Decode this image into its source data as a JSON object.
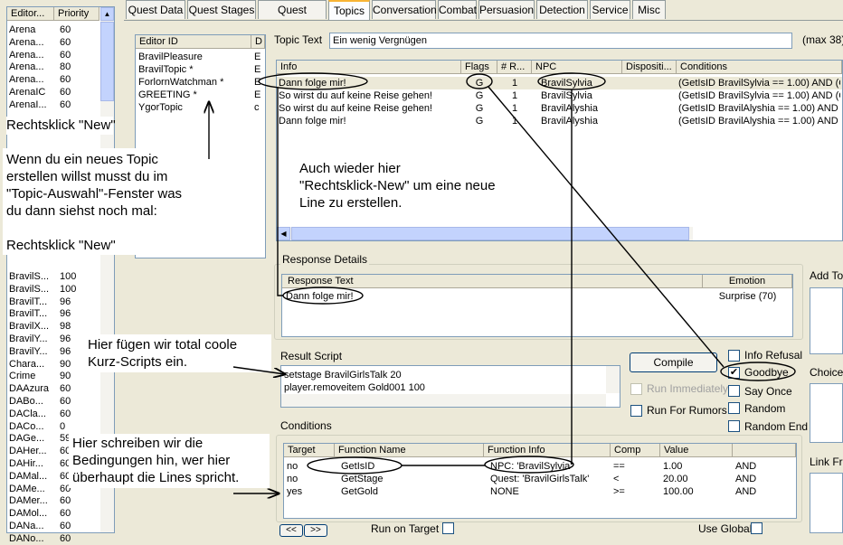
{
  "left_list": {
    "headers": [
      "Editor...",
      "Priority"
    ],
    "rows_top": [
      [
        "Arena",
        "60"
      ],
      [
        "Arena...",
        "60"
      ],
      [
        "Arena...",
        "60"
      ],
      [
        "Arena...",
        "80"
      ],
      [
        "Arena...",
        "60"
      ],
      [
        "ArenaIC",
        "60"
      ],
      [
        "ArenaI...",
        "60"
      ]
    ],
    "rows_bottom": [
      [
        "BravilS...",
        "100"
      ],
      [
        "BravilS...",
        "100"
      ],
      [
        "BravilT...",
        "96"
      ],
      [
        "BravilT...",
        "96"
      ],
      [
        "BravilX...",
        "98"
      ],
      [
        "BravilY...",
        "96"
      ],
      [
        "BravilY...",
        "96"
      ],
      [
        "Chara...",
        "90"
      ],
      [
        "Crime",
        "90"
      ],
      [
        "DAAzura",
        "60"
      ],
      [
        "DABo...",
        "60"
      ],
      [
        "DACla...",
        "60"
      ],
      [
        "DACo...",
        "0"
      ],
      [
        "DAGe...",
        "59"
      ],
      [
        "DAHer...",
        "60"
      ],
      [
        "DAHir...",
        "60"
      ],
      [
        "DAMal...",
        "60"
      ],
      [
        "DAMe...",
        "60"
      ],
      [
        "DAMer...",
        "60"
      ],
      [
        "DAMol...",
        "60"
      ],
      [
        "DANa...",
        "60"
      ],
      [
        "DANo...",
        "60"
      ]
    ]
  },
  "tabs": [
    "Quest Data",
    "Quest Stages",
    "Quest Targets",
    "Topics",
    "Conversation",
    "Combat",
    "Persuasion",
    "Detection",
    "Service",
    "Misc"
  ],
  "topic_list": {
    "headers": [
      "Editor ID",
      "D"
    ],
    "rows": [
      [
        "BravilPleasure",
        "E"
      ],
      [
        "BravilTopic *",
        "E"
      ],
      [
        "ForlornWatchman *",
        "E"
      ],
      [
        "GREETING *",
        "E"
      ],
      [
        "YgorTopic",
        "c"
      ]
    ]
  },
  "topic_text": {
    "label": "Topic Text",
    "value": "Ein wenig Vergnügen",
    "max": "(max 38)"
  },
  "info_list": {
    "headers": [
      "Info",
      "Flags",
      "# R...",
      "NPC",
      "Dispositi...",
      "Conditions"
    ],
    "rows": [
      [
        "Dann folge mir!",
        "G",
        "1",
        "BravilSylvia",
        "",
        "(GetIsID BravilSylvia == 1.00) AND (G"
      ],
      [
        "So wirst du auf keine Reise gehen!",
        "G",
        "1",
        "BravilSylvia",
        "",
        "(GetIsID BravilSylvia == 1.00) AND (G"
      ],
      [
        "So wirst du auf keine Reise gehen!",
        "G",
        "1",
        "BravilAlyshia",
        "",
        "(GetIsID BravilAlyshia == 1.00) AND ("
      ],
      [
        "Dann folge mir!",
        "G",
        "1",
        "BravilAlyshia",
        "",
        "(GetIsID BravilAlyshia == 1.00) AND ("
      ]
    ]
  },
  "response": {
    "group_label": "Response Details",
    "headers": [
      "Response Text",
      "Emotion"
    ],
    "rows": [
      [
        "Dann folge mir!",
        "Surprise (70)"
      ]
    ]
  },
  "add_topics_label": "Add Top",
  "choices_label": "Choices",
  "link_from_label": "Link Fro",
  "result_script": {
    "label": "Result Script",
    "lines": [
      "setstage BravilGirlsTalk 20",
      "player.removeitem Gold001 100"
    ]
  },
  "compile_label": "Compile",
  "run_immediately_label": "Run Immediately",
  "run_for_rumors_label": "Run For Rumors",
  "flags": [
    {
      "label": "Info Refusal",
      "checked": false
    },
    {
      "label": "Goodbye",
      "checked": true
    },
    {
      "label": "Say Once",
      "checked": false
    },
    {
      "label": "Random",
      "checked": false
    },
    {
      "label": "Random End",
      "checked": false
    }
  ],
  "conditions": {
    "label": "Conditions",
    "headers": [
      "Target",
      "Function Name",
      "Function Info",
      "Comp",
      "Value",
      ""
    ],
    "rows": [
      [
        "no",
        "GetIsID",
        "NPC: 'BravilSylvia'",
        "==",
        "1.00",
        "AND"
      ],
      [
        "no",
        "GetStage",
        "Quest: 'BravilGirlsTalk'",
        "<",
        "20.00",
        "AND"
      ],
      [
        "yes",
        "GetGold",
        "NONE",
        ">=",
        "100.00",
        "AND"
      ]
    ]
  },
  "nav_buttons": [
    "<<",
    ">>"
  ],
  "run_on_target_label": "Run on Target",
  "use_global_label": "Use Global",
  "notes": {
    "rechtsklick1": "Rechtsklick \"New\"",
    "wenn_lines": [
      "Wenn du ein neues Topic",
      "erstellen willst musst du im",
      "\"Topic-Auswahl\"-Fenster was",
      "du dann siehst noch mal:"
    ],
    "rechtsklick2": "Rechtsklick \"New\"",
    "auch_lines": [
      "Auch wieder hier",
      "\"Rechtsklick-New\" um eine neue",
      "Line zu erstellen."
    ],
    "hier_script_lines": [
      "Hier fügen wir total coole",
      "Kurz-Scripts ein."
    ],
    "hier_cond_lines": [
      "Hier schreiben wir die",
      "Bedingungen hin, wer hier",
      "überhaupt die Lines spricht."
    ]
  },
  "colors": {
    "annotation": "#000000",
    "window_bg": "#ece9d8",
    "tab_accent": "#f8b334",
    "field_border": "#7f9db9"
  }
}
